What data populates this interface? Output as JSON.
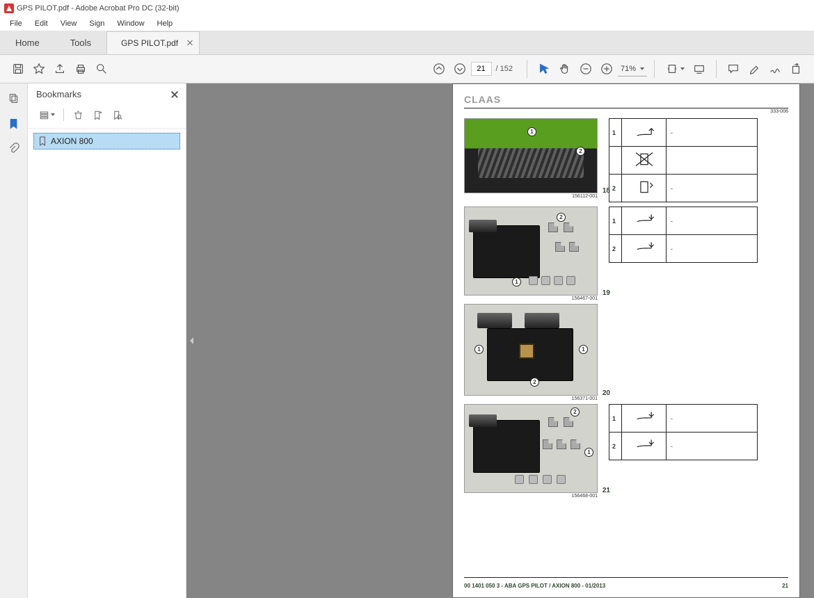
{
  "window": {
    "title": "GPS PILOT.pdf - Adobe Acrobat Pro DC (32-bit)"
  },
  "menubar": [
    "File",
    "Edit",
    "View",
    "Sign",
    "Window",
    "Help"
  ],
  "tabs": {
    "home": "Home",
    "tools": "Tools",
    "file": "GPS PILOT.pdf"
  },
  "toolbar": {
    "page_current": "21",
    "page_total": "/  152",
    "zoom": "71%"
  },
  "bookmarks": {
    "title": "Bookmarks",
    "items": [
      "AXION 800"
    ]
  },
  "document": {
    "brand": "CLAAS",
    "doc_id_top": "333-006",
    "figures": [
      {
        "caption": "156112-001",
        "num": "18"
      },
      {
        "caption": "156467-001",
        "num": "19"
      },
      {
        "caption": "156371-001",
        "num": "20"
      },
      {
        "caption": "156468-001",
        "num": "21"
      }
    ],
    "tables": {
      "t1": [
        {
          "n": "1",
          "t": "-"
        },
        {
          "n": "",
          "t": ""
        },
        {
          "n": "2",
          "t": "-"
        }
      ],
      "t2": [
        {
          "n": "1",
          "t": "-"
        },
        {
          "n": "2",
          "t": "-"
        }
      ],
      "t4": [
        {
          "n": "1",
          "t": "-"
        },
        {
          "n": "2",
          "t": "-"
        }
      ]
    },
    "footer_left": "00 1401 050 3 - ABA GPS PILOT / AXION 800 - 01/2013",
    "footer_right": "21"
  }
}
